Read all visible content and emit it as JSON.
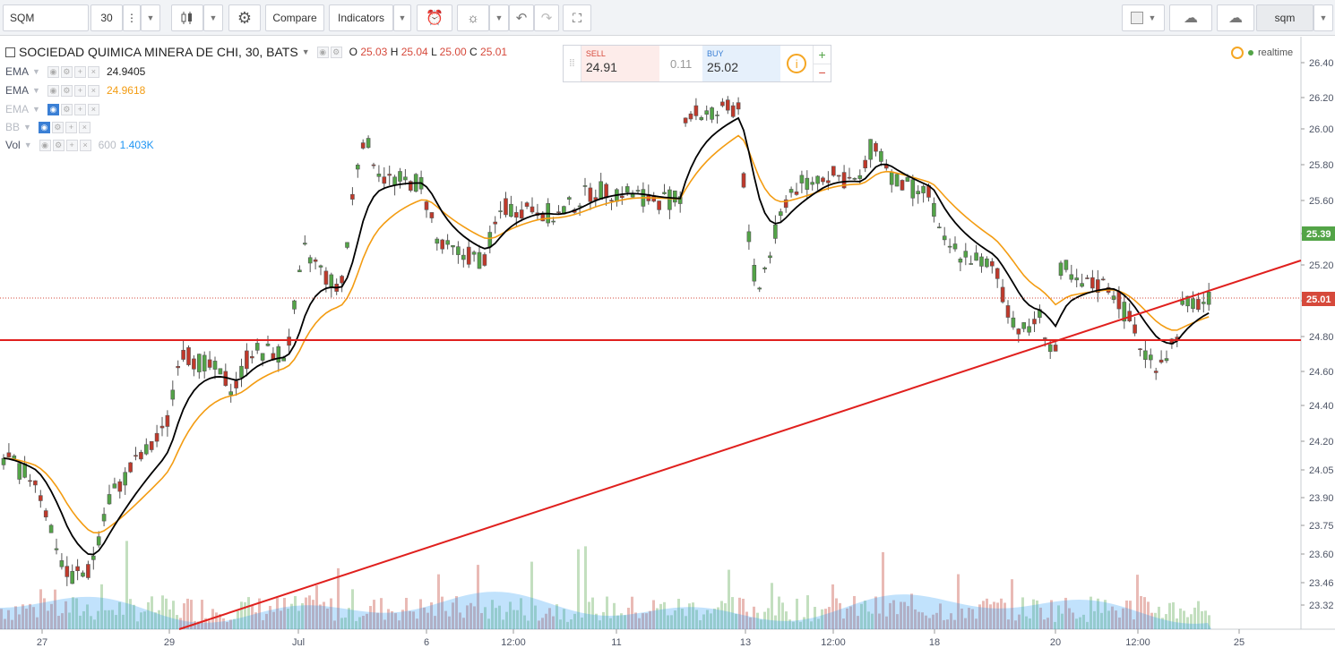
{
  "toolbar": {
    "symbol": "SQM",
    "interval": "30",
    "compare_label": "Compare",
    "indicators_label": "Indicators",
    "layout_name": "sqm"
  },
  "header": {
    "title": "SOCIEDAD QUIMICA MINERA DE CHI, 30, BATS",
    "ohlc": {
      "o_label": "O",
      "o": "25.03",
      "h_label": "H",
      "h": "25.04",
      "l_label": "L",
      "l": "25.00",
      "c_label": "C",
      "c": "25.01"
    },
    "realtime_label": "realtime"
  },
  "legend": [
    {
      "name": "EMA",
      "value": "24.9405",
      "color": "#000000"
    },
    {
      "name": "EMA",
      "value": "24.9618",
      "color": "#f39c12"
    },
    {
      "name": "EMA",
      "value": "",
      "color": "#b8bcc4"
    },
    {
      "name": "BB",
      "value": "",
      "color": "#b8bcc4"
    },
    {
      "name": "Vol",
      "param": "600",
      "value": "1.403K",
      "color": "#2196f3"
    }
  ],
  "trade_panel": {
    "sell_label": "SELL",
    "sell": "24.91",
    "spread": "0.11",
    "buy_label": "BUY",
    "buy": "25.02",
    "plus": "+",
    "minus": "−",
    "info": "i"
  },
  "price_axis": {
    "ticks": [
      "26.40",
      "26.20",
      "26.00",
      "25.80",
      "25.60",
      "25.40",
      "25.20",
      "25.00",
      "24.80",
      "24.60",
      "24.40",
      "24.20",
      "24.05",
      "23.90",
      "23.75",
      "23.60",
      "23.46",
      "23.32"
    ],
    "badges": [
      {
        "value": "25.39",
        "color": "#53a447"
      },
      {
        "value": "25.01",
        "color": "#d6493b"
      }
    ]
  },
  "time_axis": [
    "27",
    "29",
    "Jul",
    "6",
    "12:00",
    "11",
    "13",
    "12:00",
    "18",
    "20",
    "12:00",
    "25"
  ],
  "colors": {
    "up": "#53a447",
    "down": "#c0392b",
    "ema_fast": "#000000",
    "ema_slow": "#f39c12",
    "trendline": "#e0201e"
  }
}
